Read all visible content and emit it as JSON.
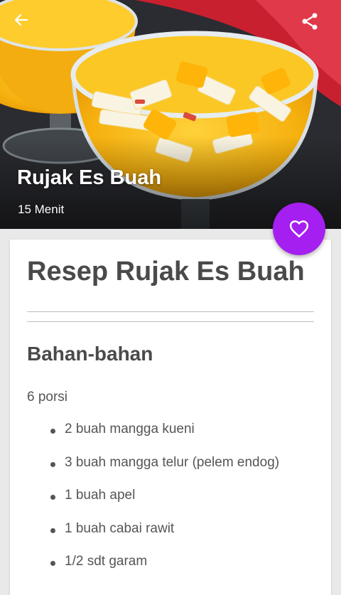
{
  "hero": {
    "title": "Rujak Es Buah",
    "duration": "15 Menit"
  },
  "recipe": {
    "title": "Resep Rujak Es Buah",
    "ingredients_heading": "Bahan-bahan",
    "servings": "6 porsi",
    "ingredients": [
      "2 buah mangga kueni",
      "3 buah mangga telur (pelem endog)",
      "1 buah apel",
      "1 buah cabai rawit",
      "1/2 sdt garam"
    ]
  },
  "icons": {
    "back": "arrow-left-icon",
    "share": "share-icon",
    "favorite": "heart-outline-icon"
  },
  "colors": {
    "accent": "#a51ff0",
    "text": "#4a4a4a",
    "background": "#e9e9e9"
  }
}
